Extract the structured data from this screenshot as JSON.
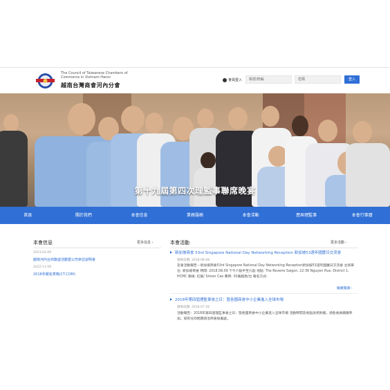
{
  "header": {
    "brand_en": "The Council of Taiwanese Chambers of Commerce in Vietnam Hanoi",
    "brand_zh": "越南台灣商會河內分會",
    "login_label": "會員登入",
    "account_placeholder": "帳號/統編",
    "password_placeholder": "密碼",
    "login_button": "登入"
  },
  "banner": {
    "title": "第十九屆第四次理監事聯席晚宴"
  },
  "nav": {
    "items": [
      "首頁",
      "關於我們",
      "本會信息",
      "業務服務",
      "本會活動",
      "歷屆理監事",
      "本會行事曆"
    ]
  },
  "news": {
    "title": "本會信息",
    "more": "更多信息 ›",
    "items": [
      {
        "date": "2023-01-09",
        "text": "越南河內台商聯誼活動暨公司參訪說明會"
      },
      {
        "date": "2022-11-09",
        "text": "2018年報名表格(CT.COM)"
      }
    ]
  },
  "activities": {
    "title": "本會活動",
    "more": "更多活動 ›",
    "items": [
      {
        "heading": "新加坡商會 53rd Singapore National Day Networking Reception 新加坡53週年國慶日交流會",
        "date": "發佈日期: 2018-08-08",
        "body": "友會活動報告－新加坡商會53rd Singapore National Day Networking Reception新加坡53週年國慶日交流會 主辦單位: 新加坡商會 時間: 2018.08.09 下午六點半至九點 地點: The Reverie Saigon, 22-36 Nguyen Hue, District 1, HCMC 聯絡: 紅賓/ Simon Cao 費用: 30萬越盾/位 報名方式:",
        "read_more": "繼續閱讀 ›"
      },
      {
        "heading": "2018年第四屆理監事會之日：暨各國商會中小企業進入全球市場",
        "date": "發佈日期: 2018-07-26",
        "body": "活動報告：2018年第四屆理監事會之日：暨各國商會中小企業進入全球市場 活動時間及地點詳見附檔，請各會員踴躍參加，如有任何問題請洽商會秘書處。"
      }
    ]
  },
  "colors": {
    "accent": "#2f6fd6",
    "nav_background": "#2f6fd6"
  }
}
